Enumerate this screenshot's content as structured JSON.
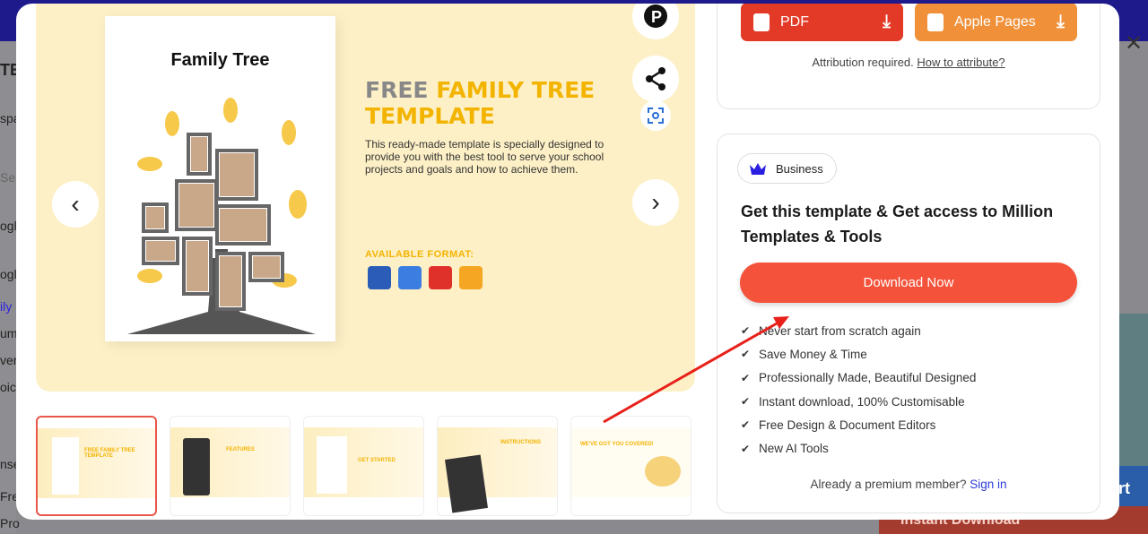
{
  "background": {
    "left_fragments": [
      "TE",
      "spa",
      "Se",
      "ogle",
      "ogle",
      "ily",
      "um",
      "ver",
      "oice",
      "nse",
      "Fre",
      "Pro"
    ],
    "right_fragment": "ort",
    "bottom_button": "Instant Download"
  },
  "preview": {
    "page_title": "Family Tree",
    "headline_part1": "FREE ",
    "headline_part2": "FAMILY TREE",
    "headline_part3": "TEMPLATE",
    "description": "This ready-made template is specially designed to provide you with the best tool to serve your school projects and goals and how to achieve them.",
    "available_format": "AVAILABLE FORMAT:",
    "formats": [
      {
        "icon": "word-icon",
        "color": "#2b5cb8"
      },
      {
        "icon": "google-docs-icon",
        "color": "#3b7de0"
      },
      {
        "icon": "pdf-icon",
        "color": "#e0302a"
      },
      {
        "icon": "pages-icon",
        "color": "#f5a623"
      }
    ]
  },
  "thumbnails": [
    {
      "label": "FREE FAMILY TREE TEMPLATE",
      "selected": true
    },
    {
      "label": "FEATURES",
      "selected": false
    },
    {
      "label": "GET STARTED",
      "selected": false
    },
    {
      "label": "INSTRUCTIONS",
      "selected": false
    },
    {
      "label": "WE'VE GOT YOU COVERED!",
      "selected": false
    }
  ],
  "downloads": {
    "pdf_label": "PDF",
    "pdf_color": "#e23a27",
    "pages_label": "Apple Pages",
    "pages_color": "#f0913a",
    "attribution_text": "Attribution required.",
    "attribution_link": "How to attribute?"
  },
  "premium": {
    "badge": "Business",
    "badge_color": "#2a1fe0",
    "headline": "Get this template & Get access to Million Templates & Tools",
    "cta": "Download Now",
    "cta_color": "#f4523a",
    "features": [
      "Never start from scratch again",
      "Save Money & Time",
      "Professionally Made, Beautiful Designed",
      "Instant download, 100% Customisable",
      "Free Design & Document Editors",
      "New AI Tools"
    ],
    "already_member": "Already a premium member?",
    "sign_in": "Sign in"
  }
}
